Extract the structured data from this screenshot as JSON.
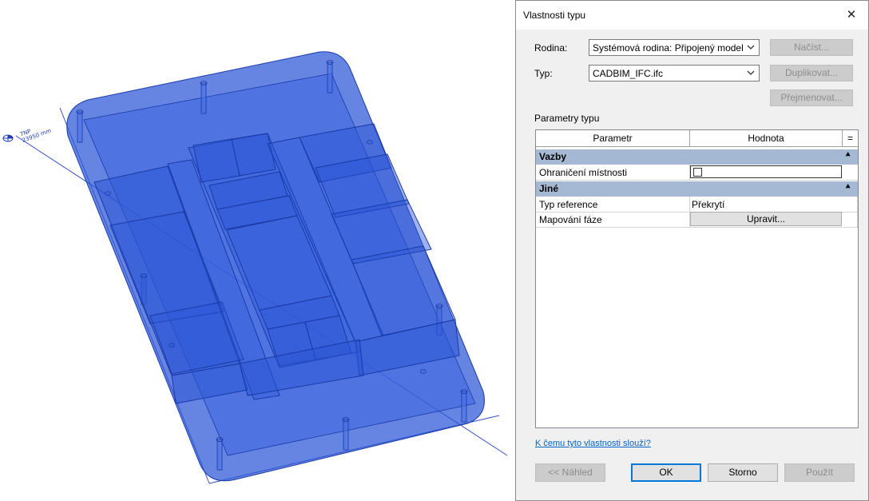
{
  "viewport": {
    "level_name": "7NP",
    "level_elevation": "23950 mm",
    "model_color": "#2b55d6"
  },
  "dialog": {
    "title": "Vlastnosti typu",
    "family_label": "Rodina:",
    "family_value": "Systémová rodina: Připojený model aplik",
    "type_label": "Typ:",
    "type_value": "CADBIM_IFC.ifc",
    "load_button": "Načíst...",
    "duplicate_button": "Duplikovat...",
    "rename_button": "Přejmenovat...",
    "type_params_label": "Parametry typu",
    "grid": {
      "col_param": "Parametr",
      "col_value": "Hodnota",
      "col_eq": "=",
      "groups": [
        {
          "name": "Vazby",
          "collapse_icon": "double-chevron-up",
          "rows": [
            {
              "param": "Ohraničení místnosti",
              "value": "",
              "checked": false
            }
          ]
        },
        {
          "name": "Jiné",
          "collapse_icon": "double-chevron-up",
          "rows": [
            {
              "param": "Typ reference",
              "value": "Překrytí"
            },
            {
              "param": "Mapování fáze",
              "value": "Upravit..."
            }
          ]
        }
      ]
    },
    "help_link": "K čemu tyto vlastnosti slouží?",
    "buttons": {
      "preview": "<< Náhled",
      "ok": "OK",
      "cancel": "Storno",
      "apply": "Použít"
    },
    "accent_color": "#0078d7",
    "group_header_color": "#a5b9d5"
  }
}
